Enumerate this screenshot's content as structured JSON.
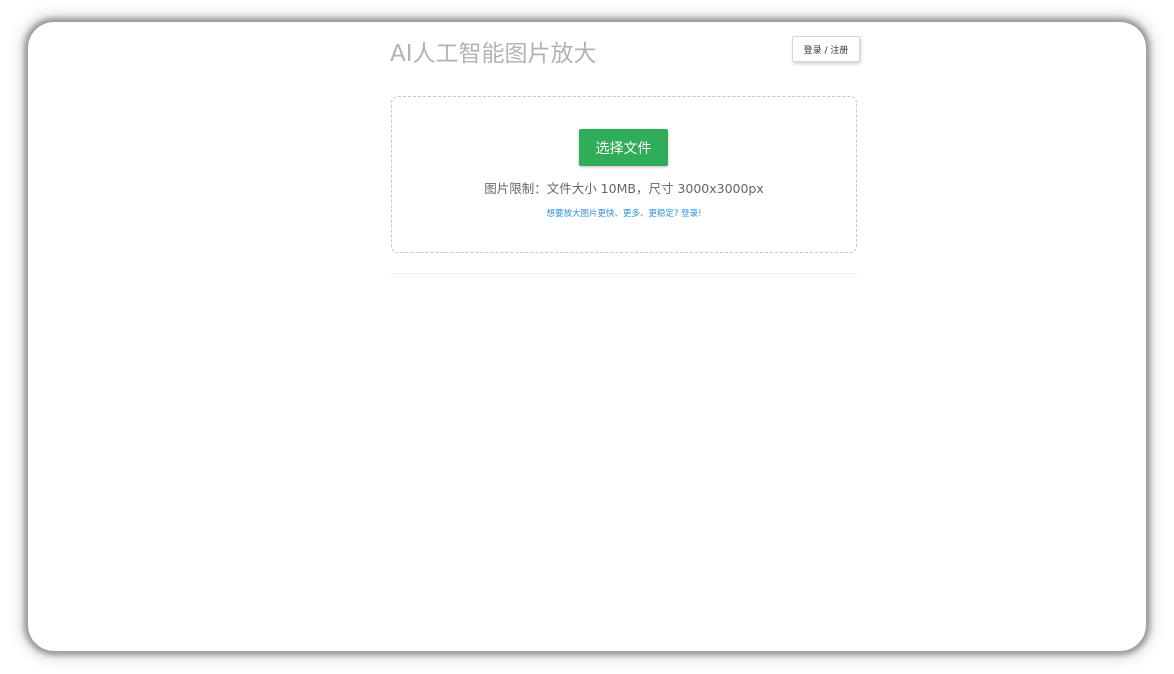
{
  "header": {
    "title": "AI人工智能图片放大",
    "login_label": "登录 / 注册"
  },
  "upload": {
    "choose_label": "选择文件",
    "limit_text": "图片限制：文件大小 10MB，尺寸 3000x3000px",
    "login_hint": "想要放大图片更快、更多、更稳定? 登录!"
  },
  "colors": {
    "primary_button": "#30ad59",
    "hint_link": "#2f8fd8",
    "title_text": "#b3b3b3"
  }
}
